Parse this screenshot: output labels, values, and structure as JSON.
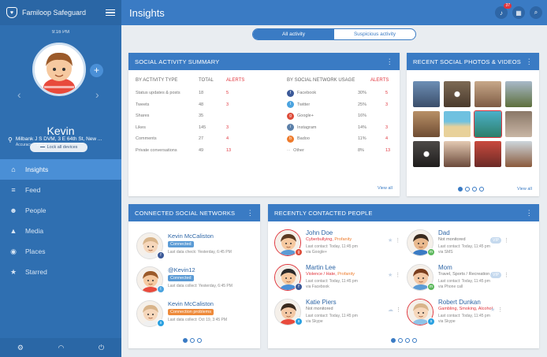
{
  "app": {
    "brand": "Familoop Safeguard",
    "page_title": "Insights",
    "notification_count": "37"
  },
  "profile": {
    "time": "9:16 PM",
    "name": "Kevin",
    "lock_label": "Lock all devices",
    "address": "Milbank J S DVM, 3 E 64th St, New ...",
    "accuracy": "Accuracy ~ 100 ft."
  },
  "menu": [
    {
      "label": "Insights",
      "icon": "bulb-icon"
    },
    {
      "label": "Feed",
      "icon": "feed-icon"
    },
    {
      "label": "People",
      "icon": "people-icon"
    },
    {
      "label": "Media",
      "icon": "media-icon"
    },
    {
      "label": "Places",
      "icon": "pin-icon"
    },
    {
      "label": "Starred",
      "icon": "star-icon"
    }
  ],
  "tabs": {
    "all": "All activity",
    "suspicious": "Suspicious activity"
  },
  "summary": {
    "title": "SOCIAL ACTIVITY SUMMARY",
    "by_type_header": "BY ACTIVITY TYPE",
    "total_header": "TOTAL",
    "alerts_header": "ALERTS",
    "by_network_header": "BY SOCIAL NETWORK USAGE",
    "alerts_header2": "ALERTS",
    "types": [
      {
        "label": "Status updates & posts",
        "total": "18",
        "alerts": "5"
      },
      {
        "label": "Tweets",
        "total": "48",
        "alerts": "3"
      },
      {
        "label": "Shares",
        "total": "35",
        "alerts": ""
      },
      {
        "label": "Likes",
        "total": "145",
        "alerts": "3"
      },
      {
        "label": "Comments",
        "total": "27",
        "alerts": "4"
      },
      {
        "label": "Private conversations",
        "total": "49",
        "alerts": "13"
      }
    ],
    "networks": [
      {
        "label": "Facebook",
        "pct": "30%",
        "alerts": "5",
        "color": "#3b5998",
        "glyph": "f"
      },
      {
        "label": "Twitter",
        "pct": "25%",
        "alerts": "3",
        "color": "#4aa3df",
        "glyph": "t"
      },
      {
        "label": "Google+",
        "pct": "16%",
        "alerts": "",
        "color": "#dd4b39",
        "glyph": "g"
      },
      {
        "label": "Instagram",
        "pct": "14%",
        "alerts": "3",
        "color": "#5b7fa8",
        "glyph": "i"
      },
      {
        "label": "Badoo",
        "pct": "11%",
        "alerts": "4",
        "color": "#ee7b2c",
        "glyph": "b"
      },
      {
        "label": "Other",
        "pct": "8%",
        "alerts": "13",
        "color": "",
        "glyph": "..."
      }
    ],
    "view_all": "View all"
  },
  "photos": {
    "title": "RECENT SOCIAL PHOTOS & VIDEOS",
    "view_all": "View all"
  },
  "networks": {
    "title": "CONNECTED SOCIAL NETWORKS",
    "items": [
      {
        "name": "Kevin McCaliston",
        "status": "Connected",
        "status_color": "#5b9bd5",
        "detail": "Last data check: Yesterday, 6:45 PM",
        "net": "f",
        "net_color": "#3b5998"
      },
      {
        "name": "@Kevin12",
        "status": "Connected",
        "status_color": "#5b9bd5",
        "detail": "Last data collect: Yesterday, 6:45 PM",
        "net": "t",
        "net_color": "#4aa3df"
      },
      {
        "name": "Kevin McCaliston",
        "status": "Connection problems",
        "status_color": "#ee8a3a",
        "detail": "Last data collect: Oct 19, 3:45 PM",
        "net": "s",
        "net_color": "#2aa0e0"
      }
    ]
  },
  "contacts": {
    "title": "RECENTLY CONTACTED PEOPLE",
    "people": [
      {
        "name": "John Doe",
        "alert": "Cyberbullying,",
        "tag": "Profanity",
        "plain": "",
        "line1": "Last contact: Today, 11:45 pm",
        "line2": "via Google+",
        "net": "g",
        "net_color": "#dd4b39"
      },
      {
        "name": "Martin Lee",
        "alert": "Violence / Hate,",
        "tag": "Profanity",
        "plain": "",
        "line1": "Last contact: Today, 11:45 pm",
        "line2": "via Facebook",
        "net": "f",
        "net_color": "#3b5998"
      },
      {
        "name": "Katie Piers",
        "alert": "",
        "tag": "",
        "plain": "Not monitored",
        "line1": "Last contact: Today, 11:45 pm",
        "line2": "via Skype",
        "net": "s",
        "net_color": "#2aa0e0"
      },
      {
        "name": "Dad",
        "alert": "",
        "tag": "",
        "plain": "Not monitored",
        "line1": "Last contact: Today, 11:45 pm",
        "line2": "via SMS",
        "net": "m",
        "net_color": "#5cb85c",
        "vip": "VIP"
      },
      {
        "name": "Mom",
        "alert": "",
        "tag": "",
        "plain": "Travel, Sports / Recreation",
        "line1": "Last contact: Today, 11:45 pm",
        "line2": "via Phone call",
        "net": "m",
        "net_color": "#5cb85c",
        "vip": "VIP"
      },
      {
        "name": "Robert Dunkan",
        "alert": "Gambling, Smoking, Alcohol",
        "tag": "",
        "plain": "",
        "line1": "Last contact: Today, 11:45 pm",
        "line2": "via Skype",
        "net": "s",
        "net_color": "#2aa0e0"
      }
    ]
  }
}
